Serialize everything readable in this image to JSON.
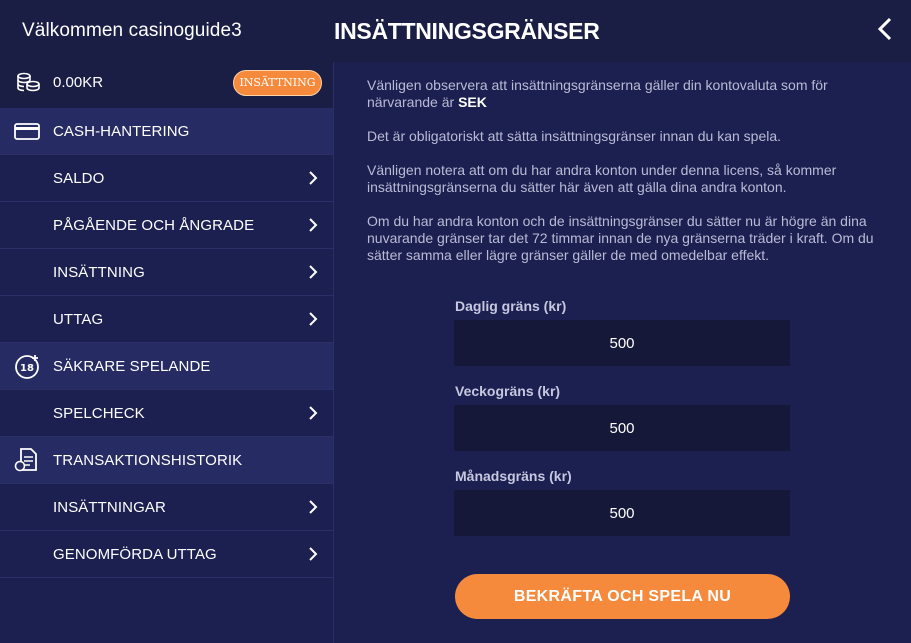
{
  "header": {
    "welcome": "Välkommen casinoguide3",
    "title": "INSÄTTNINGSGRÄNSER",
    "back_icon": "chevron-left-icon"
  },
  "account": {
    "balance": "0.00KR",
    "deposit_badge": "INSÄTTNING",
    "balance_icon": "coins-icon"
  },
  "menu": {
    "cash_section": {
      "label": "CASH-HANTERING",
      "icon": "credit-card-icon"
    },
    "saldo": "SALDO",
    "pending": "PÅGÅENDE OCH ÅNGRADE",
    "deposit": "INSÄTTNING",
    "withdraw": "UTTAG",
    "safe_section": {
      "label": "SÄKRARE SPELANDE",
      "icon": "age-18-plus-icon"
    },
    "spelcheck": "SPELCHECK",
    "history_section": {
      "label": "TRANSAKTIONSHISTORIK",
      "icon": "document-icon"
    },
    "deposits": "INSÄTTNINGAR",
    "withdrawals": "GENOMFÖRDA UTTAG"
  },
  "info": {
    "p1_text": "Vänligen observera att insättningsgränserna gäller din kontovaluta som för närvarande är ",
    "p1_currency": "SEK",
    "p2": "Det är obligatoriskt att sätta insättningsgränser innan du kan spela.",
    "p3": "Vänligen notera att om du har andra konton under denna licens, så kommer insättningsgränserna du sätter här även att gälla dina andra konton.",
    "p4": "Om du har andra konton och de insättningsgränser du sätter nu är högre än dina nuvarande gränser tar det 72 timmar innan de nya gränserna träder i kraft. Om du sätter samma eller lägre gränser gäller de med omedelbar effekt."
  },
  "limits": {
    "daily": {
      "label": "Daglig gräns (kr)",
      "value": "500"
    },
    "weekly": {
      "label": "Veckogräns (kr)",
      "value": "500"
    },
    "monthly": {
      "label": "Månadsgräns (kr)",
      "value": "500"
    }
  },
  "confirm_label": "BEKRÄFTA OCH SPELA NU",
  "colors": {
    "background": "#1a1d44",
    "panel": "#1c2050",
    "section": "#272b63",
    "accent": "#f58a3c",
    "input": "#151838"
  }
}
